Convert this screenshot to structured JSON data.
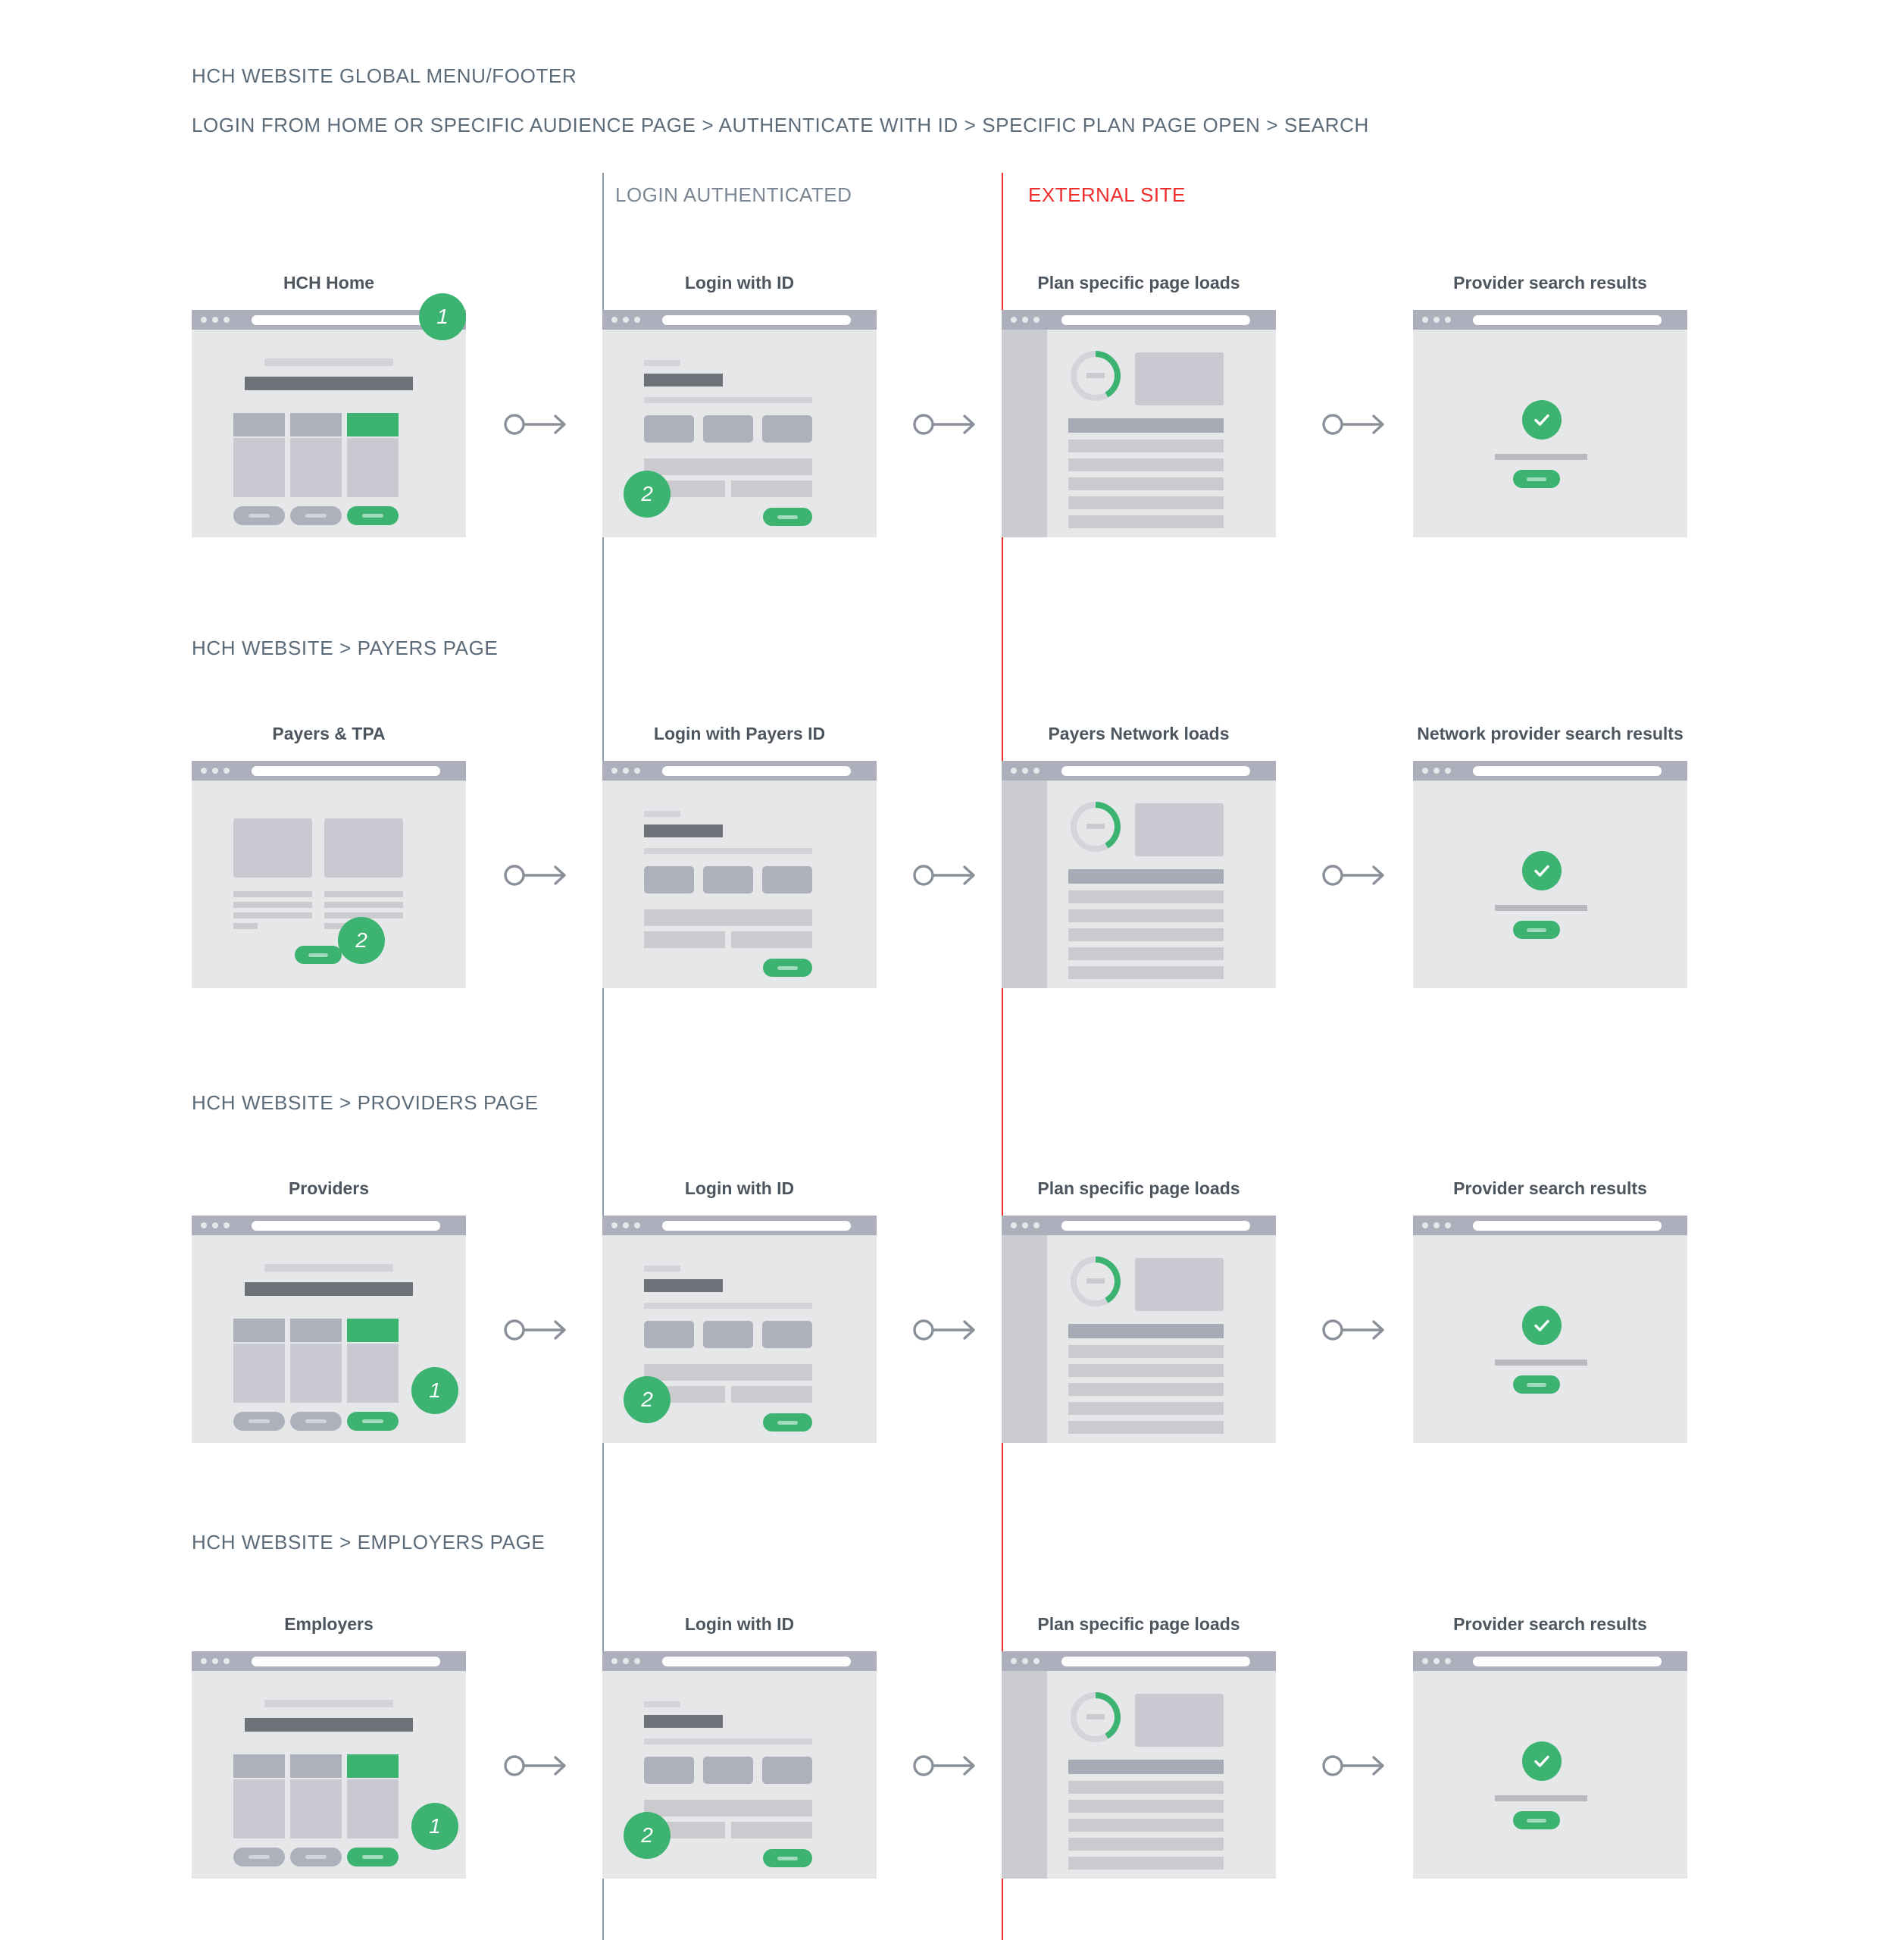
{
  "headings": {
    "line1": "HCH WEBSITE GLOBAL MENU/FOOTER",
    "line2": "LOGIN FROM HOME OR SPECIFIC AUDIENCE PAGE > AUTHENTICATE WITH ID > SPECIFIC PLAN PAGE OPEN > SEARCH"
  },
  "columns": {
    "login_authenticated": "LOGIN AUTHENTICATED",
    "external_site": "EXTERNAL SITE"
  },
  "colors": {
    "accent_green": "#3cb371",
    "external_red": "#ef2d2d",
    "heading_slate": "#5c6b7a",
    "card_title": "#4d565f",
    "chrome_grey": "#adb0bc",
    "viewport_grey": "#e6e7e9"
  },
  "sections": [
    {
      "label": "",
      "cards": [
        {
          "title": "HCH Home",
          "layout": "hero",
          "badge": "1",
          "badge_pos": "top-right"
        },
        {
          "title": "Login with ID",
          "layout": "login",
          "badge": "2",
          "badge_pos": "bottom-left"
        },
        {
          "title": "Plan specific page loads",
          "layout": "plan",
          "badge": "",
          "badge_pos": ""
        },
        {
          "title": "Provider search results",
          "layout": "result",
          "badge": "",
          "badge_pos": ""
        }
      ]
    },
    {
      "label": "HCH WEBSITE > PAYERS PAGE",
      "cards": [
        {
          "title": "Payers & TPA",
          "layout": "twocol",
          "badge": "2",
          "badge_pos": "bottom-mid"
        },
        {
          "title": "Login with Payers ID",
          "layout": "login",
          "badge": "",
          "badge_pos": ""
        },
        {
          "title": "Payers Network loads",
          "layout": "plan",
          "badge": "",
          "badge_pos": ""
        },
        {
          "title": "Network provider search results",
          "layout": "result",
          "badge": "",
          "badge_pos": ""
        }
      ]
    },
    {
      "label": "HCH WEBSITE > PROVIDERS PAGE",
      "cards": [
        {
          "title": "Providers",
          "layout": "hero",
          "badge": "1",
          "badge_pos": "bottom-right"
        },
        {
          "title": "Login with ID",
          "layout": "login",
          "badge": "2",
          "badge_pos": "bottom-left"
        },
        {
          "title": "Plan specific page loads",
          "layout": "plan",
          "badge": "",
          "badge_pos": ""
        },
        {
          "title": "Provider search results",
          "layout": "result",
          "badge": "",
          "badge_pos": ""
        }
      ]
    },
    {
      "label": "HCH WEBSITE > EMPLOYERS PAGE",
      "cards": [
        {
          "title": "Employers",
          "layout": "hero",
          "badge": "1",
          "badge_pos": "bottom-right"
        },
        {
          "title": "Login with ID",
          "layout": "login",
          "badge": "2",
          "badge_pos": "bottom-left"
        },
        {
          "title": "Plan specific page loads",
          "layout": "plan",
          "badge": "",
          "badge_pos": ""
        },
        {
          "title": "Provider search results",
          "layout": "result",
          "badge": "",
          "badge_pos": ""
        }
      ]
    }
  ]
}
